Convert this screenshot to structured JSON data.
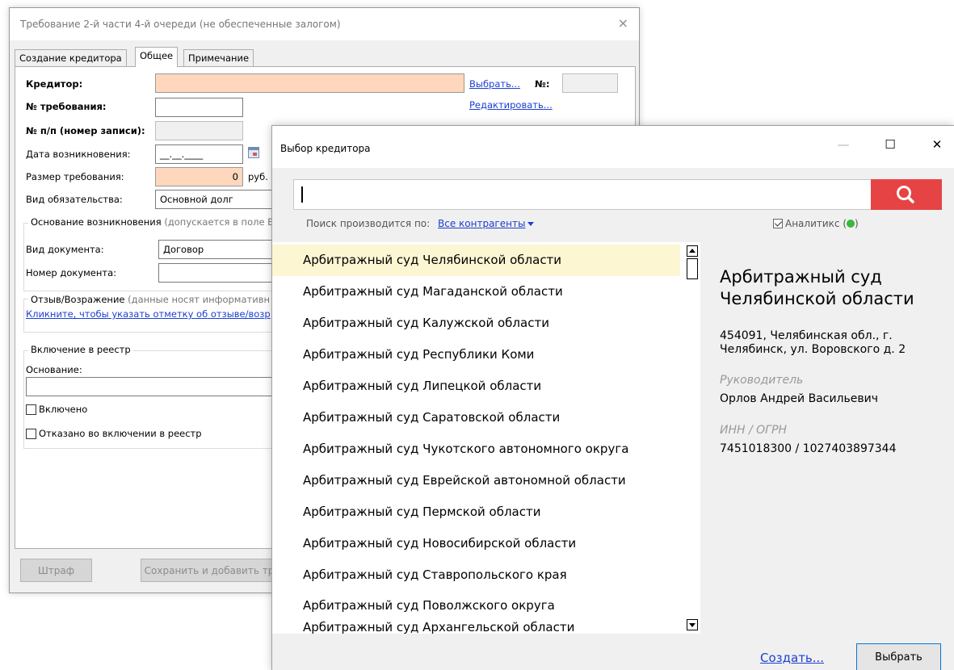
{
  "back_window": {
    "title": "Требование 2-й части 4-й очереди (не обеспеченные залогом)",
    "close_glyph": "×",
    "tabs": [
      "Создание кредитора",
      "Общее",
      "Примечание"
    ],
    "form": {
      "creditor_label": "Кредитор:",
      "creditor_value": "",
      "choose_link": "Выбрать...",
      "number_label": "№:",
      "number_value": "",
      "edit_link": "Редактировать...",
      "claim_number_label": "№ требования:",
      "claim_number_value": "",
      "record_number_label": "№ п/п (номер записи):",
      "record_number_value": "",
      "date_label": "Дата возникновения:",
      "date_value": "__.__.____",
      "amount_label": "Размер требования:",
      "amount_value": "0",
      "amount_unit": "руб.",
      "obligation_label": "Вид обязательства:",
      "obligation_value": "Основной долг",
      "basis_group_title": "Основание возникновения",
      "basis_group_hint": "(допускается в поле В",
      "doc_type_label": "Вид документа:",
      "doc_type_value": "Договор",
      "doc_number_label": "Номер документа:",
      "doc_number_value": "",
      "review_title": "Отзыв/Возражение",
      "review_hint": "(данные носят информативн",
      "review_link": "Кликните, чтобы указать отметку об отзыве/возр",
      "registry_group_title": "Включение в реестр",
      "reason_label": "Основание:",
      "reason_value": "",
      "included_label": "Включено",
      "refused_label": "Отказано во включении в реестр"
    },
    "buttons": {
      "fine": "Штраф",
      "save_add": "Сохранить и добавить тр"
    }
  },
  "dialog": {
    "title": "Выбор кредитора",
    "controls": {
      "minimize": "—",
      "maximize": "☐",
      "close": "✕"
    },
    "search": {
      "value": "",
      "hint_prefix": "Поиск производится по:",
      "scope": "Все контрагенты",
      "analytics_label": "Аналитикс ("
    },
    "colors": {
      "search_button": "#e64444",
      "status_dot": "#3ab93a",
      "selected_row": "#fdf6d3"
    },
    "list": [
      "Арбитражный суд Челябинской области",
      "Арбитражный суд Магаданской области",
      "Арбитражный суд Калужской области",
      "Арбитражный суд Республики Коми",
      "Арбитражный суд Липецкой области",
      "Арбитражный суд Саратовской области",
      "Арбитражный суд Чукотского автономного округа",
      "Арбитражный суд Еврейской автономной области",
      "Арбитражный суд Пермской области",
      "Арбитражный суд Новосибирской области",
      "Арбитражный суд Ставропольского края",
      "Арбитражный суд Поволжского округа",
      "Арбитражный суд Архангельской области"
    ],
    "detail": {
      "name": "Арбитражный суд Челябинской области",
      "address": "454091, Челябинская обл., г. Челябинск, ул. Воровского д. 2",
      "head_caption": "Руководитель",
      "head_value": "Орлов Андрей Васильевич",
      "ids_caption": "ИНН / ОГРН",
      "ids_value": "7451018300 / 1027403897344"
    },
    "footer": {
      "create_link": "Создать...",
      "choose_button": "Выбрать"
    }
  }
}
